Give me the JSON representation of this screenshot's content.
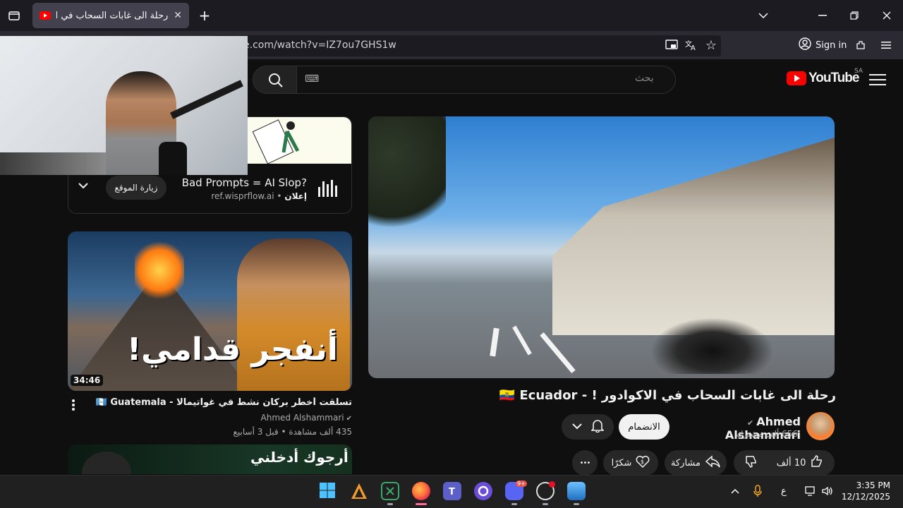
{
  "browser": {
    "tab_title": "رحلة الى غابات السحاب في الاكوادور ! - Ecuador",
    "url": "e.com/watch?v=IZ7ou7GHS1w",
    "signin_label": "Sign in",
    "close_tab": "✕",
    "new_tab": "+"
  },
  "youtube": {
    "search_placeholder": "بحث",
    "keyboard_icon": "⌨",
    "logo_text": "YouTube",
    "region": "SA"
  },
  "video": {
    "title": "رحلة الى غابات السحاب في الاكوادور ! - 🇪🇨 Ecuador",
    "channel_name": "Ahmed Alshammari",
    "verified": "✔",
    "subscribers": "656 ألف مشترك",
    "join_label": "الانضمام",
    "like_count": "10 ألف",
    "share_label": "مشاركة",
    "thanks_label": "شكرًا",
    "more_label": "•••"
  },
  "sidebar": {
    "ad": {
      "title": "Bad Prompts = AI Slop?",
      "badge": "إعلان",
      "domain": "ref.wisprflow.ai",
      "visit_label": "زيارة الموقع"
    },
    "rec1": {
      "thumbnail_text": "أنفجر قدامي!",
      "duration": "34:46",
      "title": "تسلقت أخطر بركان نشط في غواتيمالا - 🇬🇹 Guatemala",
      "channel": "Ahmed Alshammari",
      "meta": "435 ألف مشاهدة • قبل 3 أسابيع"
    },
    "rec2": {
      "thumbnail_text": "أرجوك أدخلني"
    }
  },
  "taskbar": {
    "time": "3:35 PM",
    "date": "12/12/2025",
    "lang": "ع",
    "badge": "9+"
  },
  "colors": {
    "youtube_red": "#ff0000",
    "background": "#0f0f0f",
    "chrome": "#2b2a33"
  }
}
